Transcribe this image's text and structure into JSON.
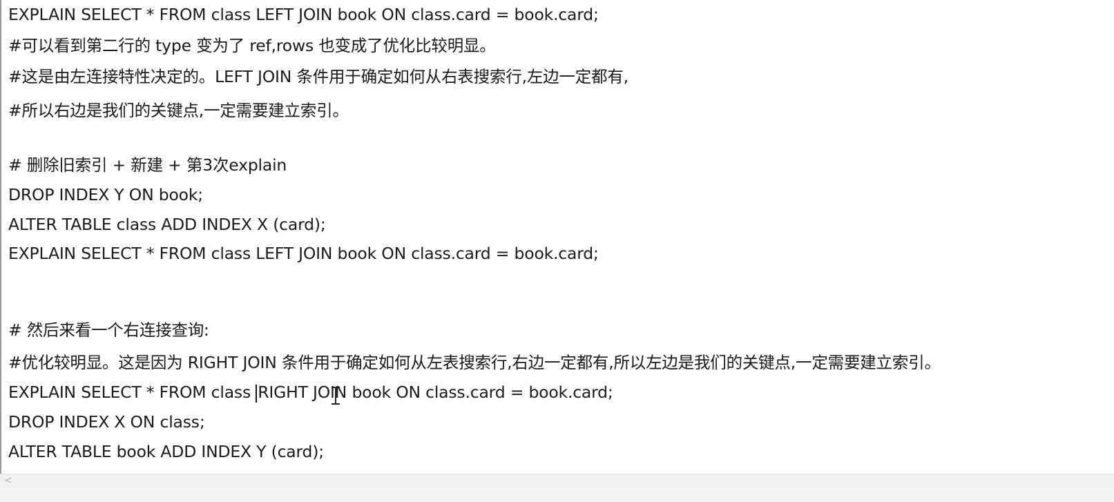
{
  "editor": {
    "lines": [
      "EXPLAIN SELECT * FROM class LEFT JOIN book ON class.card = book.card;",
      "#可以看到第二行的 type 变为了 ref,rows 也变成了优化比较明显。",
      "#这是由左连接特性决定的。LEFT JOIN 条件用于确定如何从右表搜索行,左边一定都有,",
      "#所以右边是我们的关键点,一定需要建立索引。",
      "",
      "# 删除旧索引 + 新建 + 第3次explain",
      "DROP INDEX Y ON book;",
      "ALTER TABLE class ADD INDEX X (card);",
      "EXPLAIN SELECT * FROM class LEFT JOIN book ON class.card = book.card;",
      "",
      "",
      "# 然后来看一个右连接查询:",
      "#优化较明显。这是因为 RIGHT JOIN 条件用于确定如何从左表搜索行,右边一定都有,所以左边是我们的关键点,一定需要建立索引。",
      "",
      "DROP INDEX X ON class;",
      "ALTER TABLE book ADD INDEX Y (card);"
    ],
    "caret_line": {
      "before": "EXPLAIN SELECT * FROM class ",
      "after": "RIGHT JOIN book ON class.card = book.card;"
    }
  },
  "scrollbar": {
    "left_arrow_icon": "chevron-left-icon",
    "left_arrow_glyph": "<"
  }
}
